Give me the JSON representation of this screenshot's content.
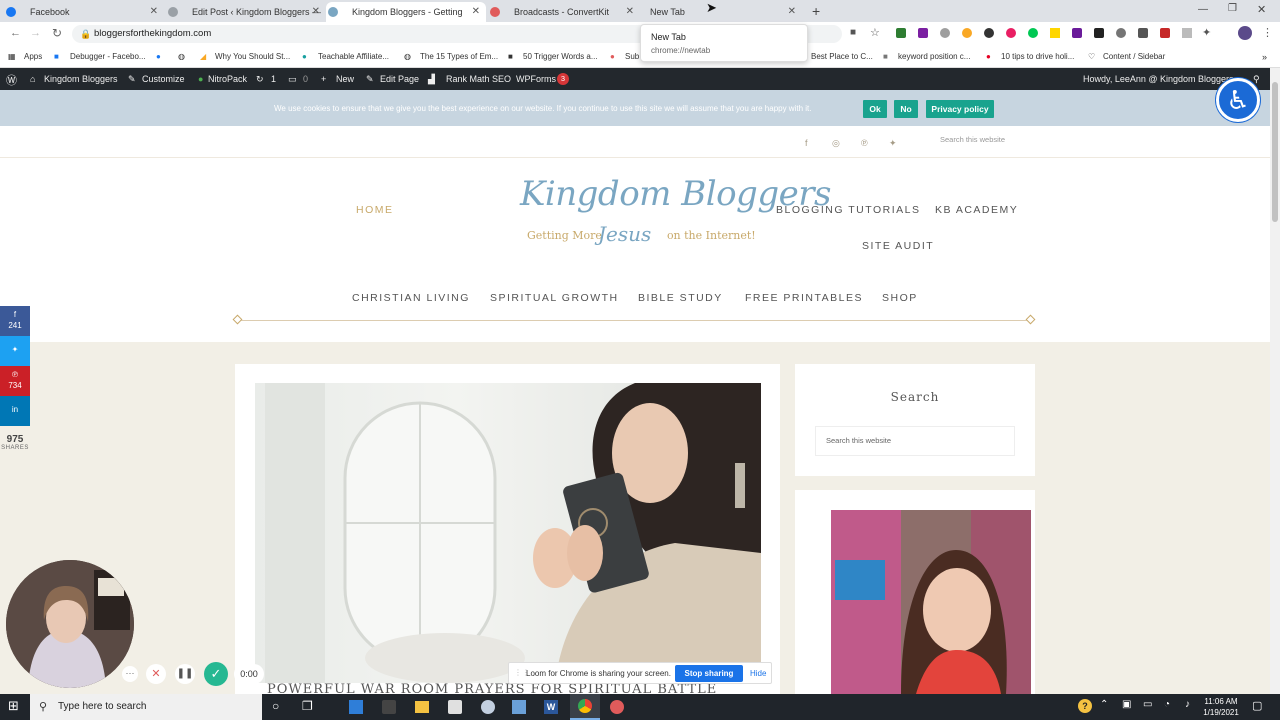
{
  "browser": {
    "tabs": [
      {
        "label": "Facebook",
        "color": "#1877f2"
      },
      {
        "label": "Edit Post ‹ Kingdom Bloggers —",
        "color": "#9aa0a6"
      },
      {
        "label": "Kingdom Bloggers - Getting",
        "color": "#7aa6c2"
      },
      {
        "label": "Broadcasts - ConvertKit",
        "color": "#e05b5b"
      },
      {
        "label": "New Tab",
        "color": "#ffffff"
      }
    ],
    "tooltip_title": "New Tab",
    "tooltip_url": "chrome://newtab",
    "url": "bloggersforthekingdom.com",
    "bookmarks": [
      "Apps",
      "Debugger - Facebo...",
      "Why You Should St...",
      "Teachable Affiliate...",
      "The 15 Types of Em...",
      "50 Trigger Words a...",
      "Sub",
      "Best Place to C...",
      "keyword position c...",
      "10 tips to drive holi...",
      "Content / Sidebar"
    ]
  },
  "wpbar": {
    "site": "Kingdom Bloggers",
    "customize": "Customize",
    "nitropack": "NitroPack",
    "updates": "1",
    "comments": "0",
    "new": "New",
    "edit": "Edit Page",
    "rankmath": "Rank Math SEO",
    "wpforms": "WPForms",
    "wpforms_badge": "3",
    "howdy": "Howdy, LeeAnn @ Kingdom Bloggers"
  },
  "cookie": {
    "message": "We use cookies to ensure that we give you the best experience on our website. If you continue to use this site we will assume that you are happy with it.",
    "ok": "Ok",
    "no": "No",
    "privacy": "Privacy policy"
  },
  "site": {
    "top_search_placeholder": "Search this website",
    "logo_line1": "Kingdom Bloggers",
    "logo_tagline_a": "Getting More",
    "logo_tagline_b": "Jesus",
    "logo_tagline_c": "on the Internet!",
    "nav_primary": [
      "HOME",
      "BLOGGING TUTORIALS",
      "KB ACADEMY",
      "SITE AUDIT"
    ],
    "nav_secondary": [
      "CHRISTIAN LIVING",
      "SPIRITUAL GROWTH",
      "BIBLE STUDY",
      "FREE PRINTABLES",
      "SHOP"
    ],
    "post_title": "POWERFUL WAR ROOM PRAYERS FOR SPIRITUAL BATTLE",
    "sidebar_search_title": "Search",
    "sidebar_search_placeholder": "Search this website"
  },
  "share": {
    "facebook_count": "241",
    "pinterest_count": "734",
    "total": "975",
    "label": "SHARES"
  },
  "loom": {
    "timer": "0:00",
    "sharing_msg": "Loom for Chrome is sharing your screen.",
    "stop": "Stop sharing",
    "hide": "Hide"
  },
  "taskbar": {
    "search_placeholder": "Type here to search",
    "time": "11:06 AM",
    "date": "1/19/2021"
  }
}
